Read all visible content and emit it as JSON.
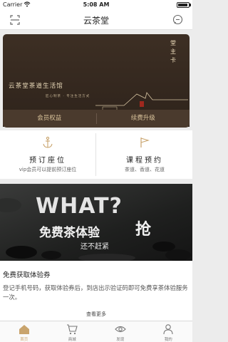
{
  "status_bar": {
    "carrier": "Carrier",
    "time": "5:08 AM"
  },
  "nav": {
    "title": "云茶堂",
    "left_icon": "scan-icon",
    "right_icon": "chat-icon"
  },
  "card": {
    "brand": "云茶堂茶道生活馆",
    "slogan": "匠心制茶 · 专注生活方式",
    "badge": "堂主卡",
    "tabs": [
      {
        "label": "会员权益"
      },
      {
        "label": "续费升级"
      }
    ]
  },
  "services": [
    {
      "name": "预订座位",
      "desc": "vip会员可以提前预订座位",
      "icon": "anchor-icon"
    },
    {
      "name": "课程预约",
      "desc": "茶道、香道、花道",
      "icon": "flag-icon"
    }
  ],
  "promo": {
    "what": "WHAT?",
    "headline": "免费茶体验",
    "grab": "抢",
    "hurry": "还不赶紧"
  },
  "trial": {
    "title": "免费获取体验券",
    "body": "登记手机号码，获取体验券后，到店出示验证码即可免费享茶体验服务一次。",
    "more": "查看更多"
  },
  "tabbar": [
    {
      "label": "首页",
      "icon": "home-icon",
      "active": true
    },
    {
      "label": "商城",
      "icon": "cart-icon",
      "active": false
    },
    {
      "label": "发现",
      "icon": "eye-icon",
      "active": false
    },
    {
      "label": "我的",
      "icon": "user-icon",
      "active": false
    }
  ],
  "colors": {
    "accent": "#c9a46d",
    "card_bg": "#3d2f24",
    "card_text": "#d8c29a"
  }
}
